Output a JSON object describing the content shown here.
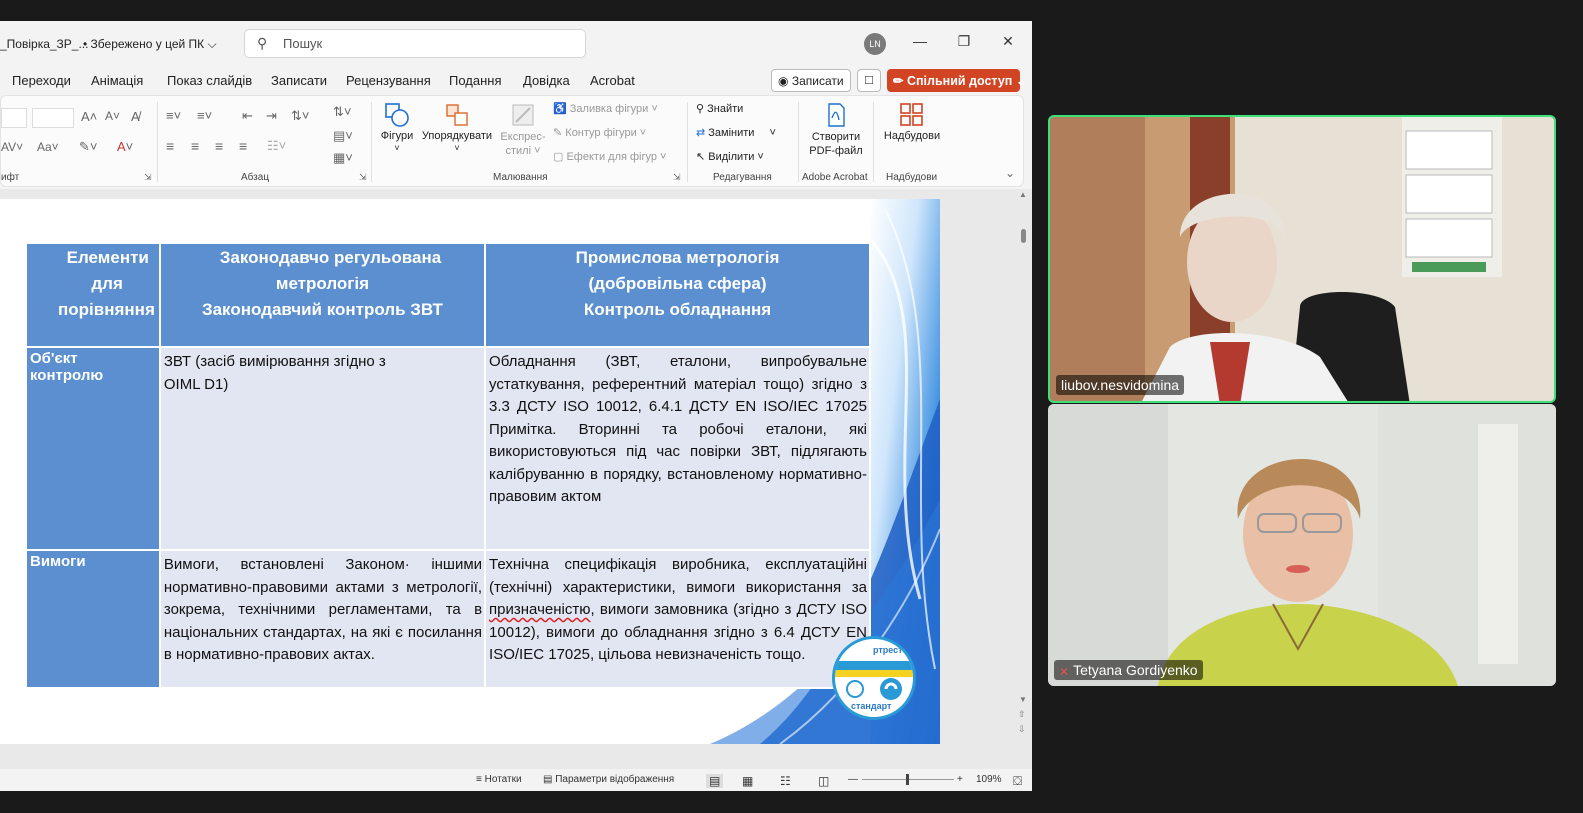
{
  "titlebar": {
    "file_name": "_Повірка_ЗР_...",
    "saved_status": "• Збережено у цей ПК",
    "search_placeholder": "Пошук",
    "avatar_initials": "LN"
  },
  "menu": {
    "items": [
      "Переходи",
      "Анімація",
      "Показ слайдів",
      "Записати",
      "Рецензування",
      "Подання",
      "Довідка",
      "Acrobat"
    ],
    "record_label": "Записати",
    "share_label": "Спільний доступ"
  },
  "ribbon": {
    "groups": {
      "font": "ифт",
      "paragraph": "Абзац",
      "drawing": "Малювання",
      "editing": "Редагування",
      "adobe": "Adobe Acrobat",
      "addins": "Надбудови"
    },
    "buttons": {
      "shapes": "Фігури",
      "arrange": "Упорядкувати",
      "quick_styles_1": "Експрес-",
      "quick_styles_2": "стилі",
      "shape_fill": "Заливка фігури",
      "shape_outline": "Контур фігури",
      "shape_effects": "Ефекти для фігур",
      "find": "Знайти",
      "replace": "Замінити",
      "select": "Виділити",
      "create_pdf_1": "Створити",
      "create_pdf_2": "PDF-файл",
      "addins": "Надбудови"
    }
  },
  "slide": {
    "table": {
      "headers": [
        [
          "Елементи",
          "для",
          "порівняння"
        ],
        [
          "Законодавчо регульована",
          "метрологія",
          "Законодавчий контроль ЗВТ"
        ],
        [
          "Промислова метрологія",
          "(добровільна сфера)",
          "Контроль обладнання"
        ]
      ],
      "row1": {
        "head": [
          "Об'єкт",
          "контролю"
        ],
        "col2": [
          "ЗВТ (засіб вимірювання згідно з",
          "OIML D1)"
        ],
        "col3": "Обладнання (ЗВТ, еталони, випробувальне устаткування, референтний матеріал тощо) згідно з 3.3 ДСТУ ISO 10012, 6.4.1 ДСТУ EN ISO/IEC 17025 Примітка. Вторинні та робочі еталони, які використовуються під час повірки ЗВТ, підлягають калібруванню в порядку, встановленому нормативно-правовим актом"
      },
      "row2": {
        "head": "Вимоги",
        "col2": "Вимоги, встановлені Законом· іншими нормативно-правовими актами з метрології, зокрема, технічними регламентами, та в національних стандартах, на які є посилання в нормативно-правових актах.",
        "col3_a": "Технічна специфікація виробника, експлуатаційні (технічні) характеристики, вимоги використання за ",
        "col3_sq": "призначеністю",
        "col3_b": ", вимоги замовника (згідно з ДСТУ ISO 10012), вимоги до обладнання згідно з 6.4 ДСТУ EN ISO/IEC 17025, цільова невизначеність тощо."
      }
    },
    "logo_text_top": "ртрест",
    "logo_text_bottom": "стандарт"
  },
  "statusbar": {
    "notes": "Нотатки",
    "view_settings": "Параметри відображення",
    "zoom": "109%"
  },
  "participants": [
    {
      "name": "liubov.nesvidomina",
      "muted": false,
      "active_speaker": true
    },
    {
      "name": "Tetyana Gordiyenko",
      "muted": true,
      "active_speaker": false
    }
  ],
  "colors": {
    "accent_share": "#d14424",
    "table_header": "#5b8fcf",
    "table_cell": "#e2e6f2",
    "speaker_border": "#3ee07a"
  }
}
